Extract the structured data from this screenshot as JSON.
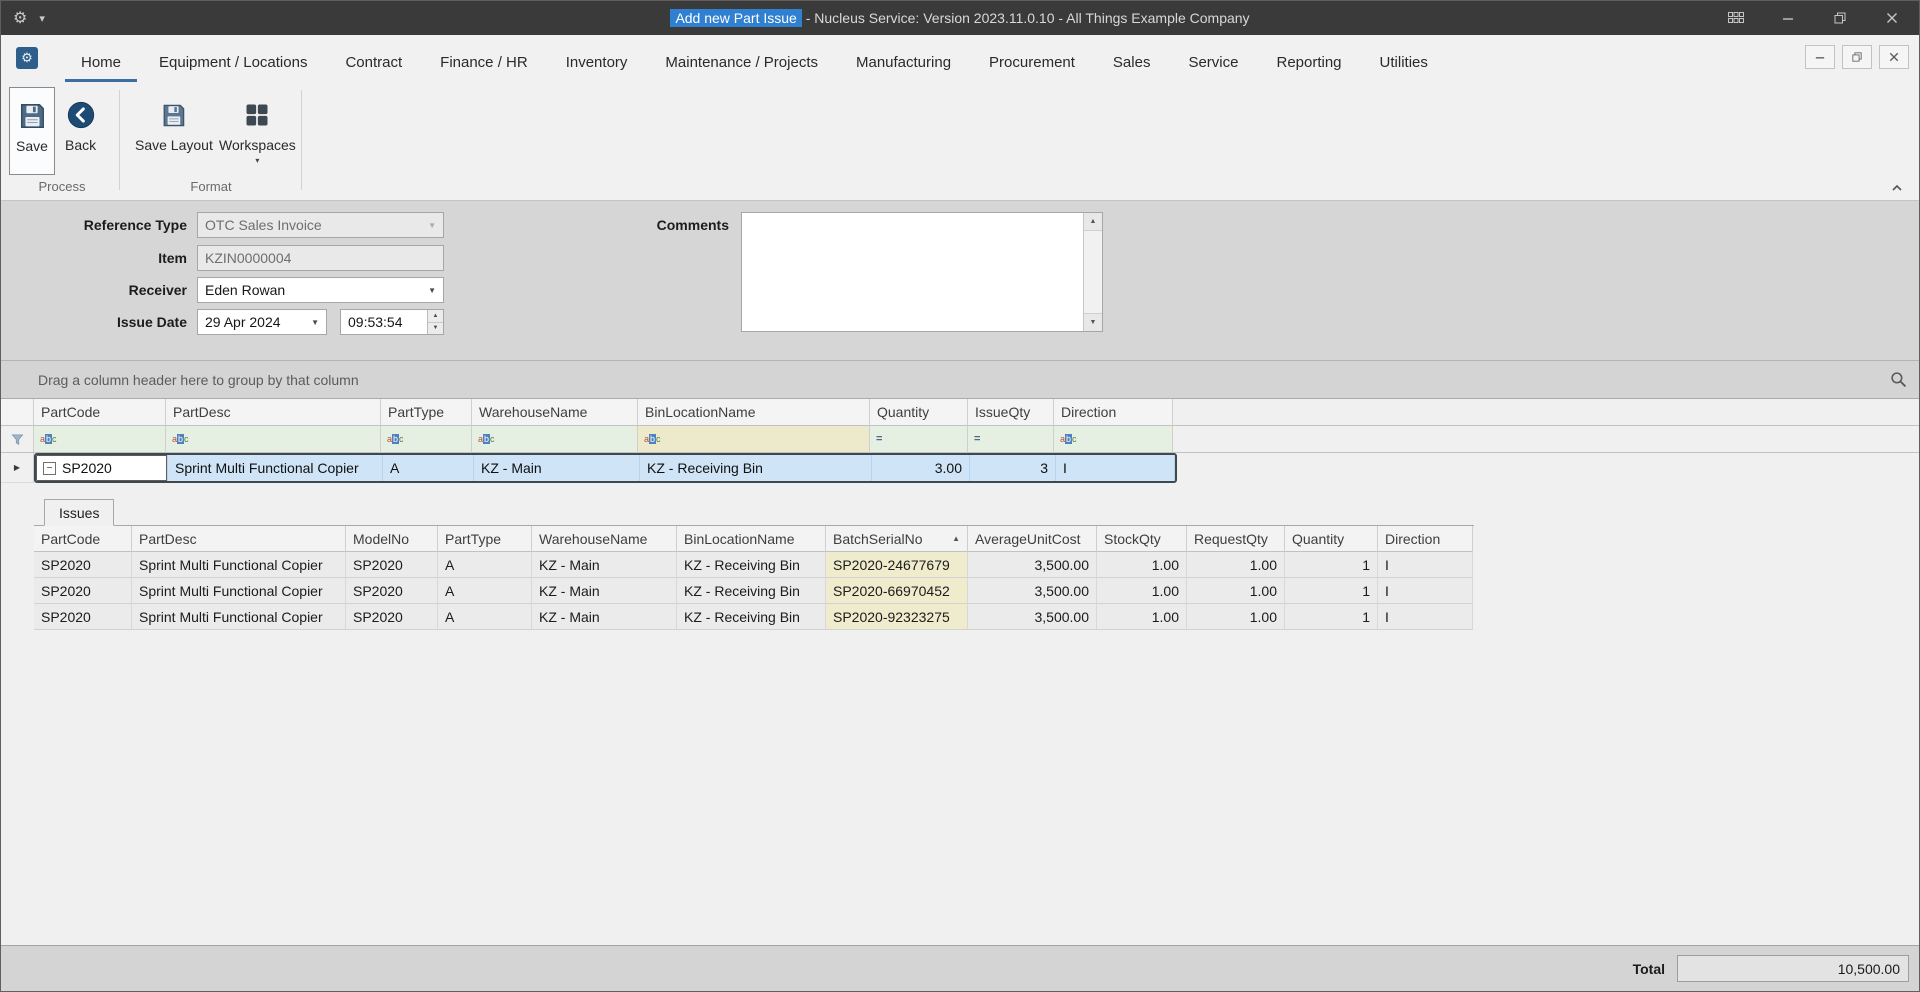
{
  "colors": {
    "titlebar_bg": "#3a3a3a",
    "title_highlight_bg": "#2f80d0",
    "active_tab_underline": "#3c6ea5",
    "selected_row_bg": "#cfe4f7",
    "filter_cell_green": "#e6f0e2",
    "filter_cell_yellow": "#edeacb",
    "serial_cell_yellow": "#efecce"
  },
  "titlebar": {
    "title_highlight": "Add new Part Issue",
    "title_rest": " - Nucleus Service: Version 2023.11.0.10 - All Things Example Company"
  },
  "ribbon": {
    "tabs": [
      "Home",
      "Equipment / Locations",
      "Contract",
      "Finance / HR",
      "Inventory",
      "Maintenance / Projects",
      "Manufacturing",
      "Procurement",
      "Sales",
      "Service",
      "Reporting",
      "Utilities"
    ],
    "active_tab": "Home",
    "buttons": {
      "save": "Save",
      "back": "Back",
      "save_layout": "Save Layout",
      "workspaces": "Workspaces"
    },
    "group_labels": {
      "process": "Process",
      "format": "Format"
    }
  },
  "form": {
    "reference_type": {
      "label": "Reference Type",
      "value": "OTC Sales Invoice"
    },
    "item": {
      "label": "Item",
      "value": "KZIN0000004"
    },
    "receiver": {
      "label": "Receiver",
      "value": "Eden Rowan"
    },
    "issue_date": {
      "label": "Issue Date",
      "date_value": "29 Apr 2024",
      "time_value": "09:53:54"
    },
    "comments": {
      "label": "Comments",
      "value": ""
    }
  },
  "master_grid": {
    "group_panel_hint": "Drag a column header here to group by that column",
    "columns": [
      "PartCode",
      "PartDesc",
      "PartType",
      "WarehouseName",
      "BinLocationName",
      "Quantity",
      "IssueQty",
      "Direction"
    ],
    "row": [
      "SP2020",
      "Sprint Multi Functional Copier",
      "A",
      "KZ - Main",
      "KZ - Receiving Bin",
      "3.00",
      "3",
      "I"
    ]
  },
  "detail_grid": {
    "tab_label": "Issues",
    "sorted_column": "BatchSerialNo",
    "columns": [
      "PartCode",
      "PartDesc",
      "ModelNo",
      "PartType",
      "WarehouseName",
      "BinLocationName",
      "BatchSerialNo",
      "AverageUnitCost",
      "StockQty",
      "RequestQty",
      "Quantity",
      "Direction"
    ],
    "rows": [
      [
        "SP2020",
        "Sprint Multi Functional Copier",
        "SP2020",
        "A",
        "KZ - Main",
        "KZ - Receiving Bin",
        "SP2020-24677679",
        "3,500.00",
        "1.00",
        "1.00",
        "1",
        "I"
      ],
      [
        "SP2020",
        "Sprint Multi Functional Copier",
        "SP2020",
        "A",
        "KZ - Main",
        "KZ - Receiving Bin",
        "SP2020-66970452",
        "3,500.00",
        "1.00",
        "1.00",
        "1",
        "I"
      ],
      [
        "SP2020",
        "Sprint Multi Functional Copier",
        "SP2020",
        "A",
        "KZ - Main",
        "KZ - Receiving Bin",
        "SP2020-92323275",
        "3,500.00",
        "1.00",
        "1.00",
        "1",
        "I"
      ]
    ]
  },
  "footer": {
    "total_label": "Total",
    "total_value": "10,500.00"
  },
  "icons": {
    "gear": "⚙",
    "caret_down": "▾",
    "combo_arrow": "▼",
    "spin_up": "▲",
    "spin_down": "▼",
    "scroll_up": "▲",
    "scroll_down": "▼",
    "row_indicator": "▶",
    "sort_asc": "▲",
    "collapse_box": "−",
    "equals_filter": "=",
    "abc_a": "a",
    "abc_b": "b",
    "abc_c": "c"
  }
}
